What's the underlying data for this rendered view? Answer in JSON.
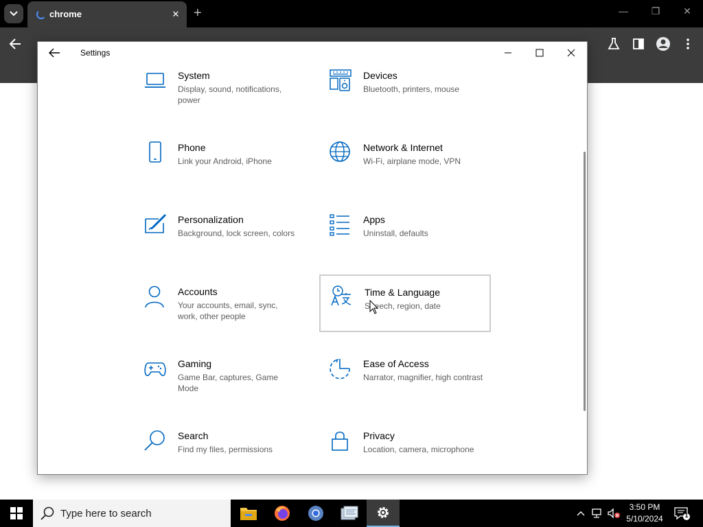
{
  "browser": {
    "tab_title": "chrome",
    "tab_close": "✕",
    "new_tab": "+",
    "minimize": "—",
    "restore": "❐",
    "close": "✕"
  },
  "window": {
    "title": "Settings"
  },
  "tiles": [
    {
      "icon": "laptop-icon",
      "title": "System",
      "description": "Display, sound, notifications, power"
    },
    {
      "icon": "devices-icon",
      "title": "Devices",
      "description": "Bluetooth, printers, mouse"
    },
    {
      "icon": "phone-icon",
      "title": "Phone",
      "description": "Link your Android, iPhone"
    },
    {
      "icon": "globe-icon",
      "title": "Network & Internet",
      "description": "Wi-Fi, airplane mode, VPN"
    },
    {
      "icon": "personalization-icon",
      "title": "Personalization",
      "description": "Background, lock screen, colors"
    },
    {
      "icon": "apps-icon",
      "title": "Apps",
      "description": "Uninstall, defaults"
    },
    {
      "icon": "person-icon",
      "title": "Accounts",
      "description": "Your accounts, email, sync, work, other people"
    },
    {
      "icon": "time-language-icon",
      "title": "Time & Language",
      "description": "Speech, region, date",
      "selected": true
    },
    {
      "icon": "gamepad-icon",
      "title": "Gaming",
      "description": "Game Bar, captures, Game Mode"
    },
    {
      "icon": "ease-of-access-icon",
      "title": "Ease of Access",
      "description": "Narrator, magnifier, high contrast"
    },
    {
      "icon": "search-icon",
      "title": "Search",
      "description": "Find my files, permissions"
    },
    {
      "icon": "lock-icon",
      "title": "Privacy",
      "description": "Location, camera, microphone"
    }
  ],
  "taskbar": {
    "search_placeholder": "Type here to search",
    "time": "3:50 PM",
    "date": "5/10/2024",
    "notification_count": "1"
  },
  "colors": {
    "accent": "#0067c0",
    "taskbar": "#000000",
    "browser_toolbar": "#3c3c3c"
  }
}
